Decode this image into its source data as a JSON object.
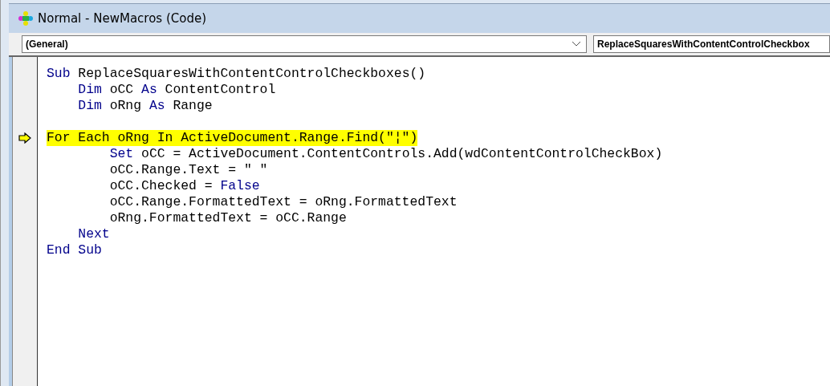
{
  "window": {
    "title": "Normal - NewMacros (Code)"
  },
  "object_dropdown": {
    "value": "(General)"
  },
  "procedure_dropdown": {
    "value": "ReplaceSquaresWithContentControlCheckbox"
  },
  "code_lines": [
    {
      "current": false,
      "tokens": [
        {
          "text": "Sub",
          "kind": "keyword"
        },
        {
          "text": " ReplaceSquaresWithContentControlCheckboxes()",
          "kind": "plain"
        }
      ]
    },
    {
      "current": false,
      "tokens": [
        {
          "text": "    Dim",
          "kind": "keyword"
        },
        {
          "text": " oCC ",
          "kind": "plain"
        },
        {
          "text": "As",
          "kind": "keyword"
        },
        {
          "text": " ContentControl",
          "kind": "plain"
        }
      ]
    },
    {
      "current": false,
      "tokens": [
        {
          "text": "    Dim",
          "kind": "keyword"
        },
        {
          "text": " oRng ",
          "kind": "plain"
        },
        {
          "text": "As",
          "kind": "keyword"
        },
        {
          "text": " Range",
          "kind": "plain"
        }
      ]
    },
    {
      "current": false
    },
    {
      "current": true,
      "tokens": [
        {
          "text": "For Each oRng In ActiveDocument.Range.Find(\"¦\")",
          "kind": "plain"
        }
      ]
    },
    {
      "current": false,
      "tokens": [
        {
          "text": "        Set",
          "kind": "keyword"
        },
        {
          "text": " oCC = ActiveDocument.ContentControls.Add(wdContentControlCheckBox)",
          "kind": "plain"
        }
      ]
    },
    {
      "current": false,
      "tokens": [
        {
          "text": "        oCC.Range.Text = \" \"",
          "kind": "plain"
        }
      ]
    },
    {
      "current": false,
      "tokens": [
        {
          "text": "        oCC.Checked = ",
          "kind": "plain"
        },
        {
          "text": "False",
          "kind": "keyword"
        }
      ]
    },
    {
      "current": false,
      "tokens": [
        {
          "text": "        oCC.Range.FormattedText = oRng.FormattedText",
          "kind": "plain"
        }
      ]
    },
    {
      "current": false,
      "tokens": [
        {
          "text": "        oRng.FormattedText = oCC.Range",
          "kind": "plain"
        }
      ]
    },
    {
      "current": false,
      "tokens": [
        {
          "text": "    Next",
          "kind": "keyword"
        }
      ]
    },
    {
      "current": false,
      "tokens": [
        {
          "text": "End Sub",
          "kind": "keyword"
        }
      ]
    }
  ]
}
